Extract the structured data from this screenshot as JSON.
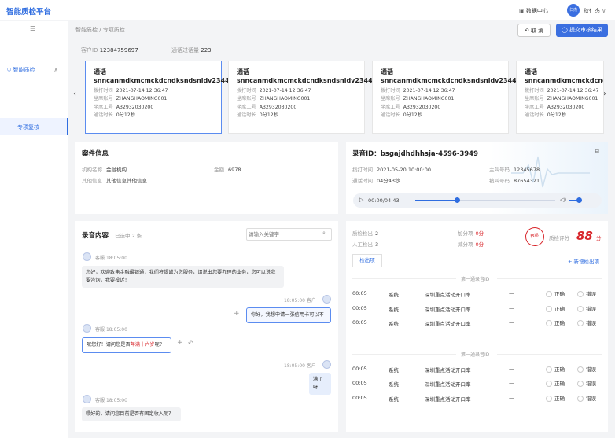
{
  "app": {
    "title": "智能质检平台",
    "data_center": "数据中心",
    "avatar_text": "仁杰",
    "user_name": "狄仁杰"
  },
  "sidebar": {
    "group": "智能质检",
    "active": "专项复核"
  },
  "breadcrumb": "智能质检 / 专项质检",
  "actions": {
    "cancel": "取 消",
    "submit": "提交审核结果"
  },
  "info": {
    "customer_id_label": "客户ID",
    "customer_id": "12384759697",
    "call_total_label": "通话过话量",
    "call_total": "223"
  },
  "cards": [
    {
      "title": "通话snncanmdkmcmckdcndksndsnidv2344455",
      "rows": [
        [
          "拨打时间",
          "2021-07-14  12:36:47"
        ],
        [
          "坐席账号",
          "ZHANGHAOMING001"
        ],
        [
          "坐席工号",
          "A32932030200"
        ],
        [
          "通话时长",
          "0分12秒"
        ]
      ]
    },
    {
      "title": "通话snncanmdkmcmckdcndksndsnidv2344455",
      "rows": [
        [
          "拨打时间",
          "2021-07-14  12:36:47"
        ],
        [
          "坐席账号",
          "ZHANGHAOMING001"
        ],
        [
          "坐席工号",
          "A32932030200"
        ],
        [
          "通话时长",
          "0分12秒"
        ]
      ]
    },
    {
      "title": "通话snncanmdkmcmckdcndksndsnidv2344455",
      "rows": [
        [
          "拨打时间",
          "2021-07-14  12:36:47"
        ],
        [
          "坐席账号",
          "ZHANGHAOMING001"
        ],
        [
          "坐席工号",
          "A32932030200"
        ],
        [
          "通话时长",
          "0分12秒"
        ]
      ]
    },
    {
      "title": "通话snncanmdkmcmckdcndksndsnidv2344455",
      "rows": [
        [
          "拨打时间",
          "2021-07-14  12:36:47"
        ],
        [
          "坐席账号",
          "ZHANGHAOMING001"
        ],
        [
          "坐席工号",
          "A32932030200"
        ],
        [
          "通话时长",
          "0分12秒"
        ]
      ]
    }
  ],
  "case": {
    "title": "案件信息",
    "org_label": "机构名称",
    "org": "金融机构",
    "amount_label": "金额",
    "amount": "6978",
    "other_label": "其他信息",
    "other": "其他信息其他信息"
  },
  "record": {
    "title": "录音ID：bsgajdhdhhsja-4596-3949",
    "call_time_label": "拨打时间",
    "call_time": "2021-05-20  10:00:00",
    "caller_label": "主叫号码",
    "caller": "12345678",
    "duration_label": "通话时间",
    "duration": "04分43秒",
    "callee_label": "被叫号码",
    "callee": "87654321",
    "player_time": "00:00/04:43",
    "progress": 0.3,
    "volume": 0.75
  },
  "content": {
    "title": "录音内容",
    "selected": "已选中 2 条",
    "search_placeholder": "请输入关键字",
    "messages": [
      {
        "role": "客服",
        "time": "18:05:00",
        "text": "您好，欢迎致电金融最银通，我们将竭诚为您服务，请说出您要办理的业务，您可以说我要咨询，我要投诉！"
      },
      {
        "role": "客户",
        "time": "18:05:00",
        "text": "你好，我想申请一张信用卡可以不"
      },
      {
        "role": "客服",
        "time": "18:05:00",
        "text_pre": "呢您好！请问您是否",
        "text_hl": "年满十六岁",
        "text_post": "呢？"
      },
      {
        "role": "客户",
        "time": "18:05:00",
        "text": "满了呀"
      },
      {
        "role": "客服",
        "time": "18:05:00",
        "text": "喂好的，请问您目前是否有固定收入呢？"
      }
    ]
  },
  "qc": {
    "detect_label": "质检检出",
    "detect": "2",
    "manual_label": "人工检出",
    "manual": "3",
    "add_label": "加分项",
    "add": "0分",
    "minus_label": "减分项",
    "minus": "0分",
    "stamp": "数据",
    "score_label": "质检评分",
    "score": "88",
    "score_unit": "分",
    "tab": "检出项",
    "add_btn": "+ 新增检出项",
    "sections": [
      {
        "label": "第一通录音ID",
        "rows": [
          [
            "00:05",
            "系统",
            "深圳重点活动开口率",
            "—"
          ],
          [
            "00:05",
            "系统",
            "深圳重点活动开口率",
            "—"
          ],
          [
            "00:05",
            "系统",
            "深圳重点活动开口率",
            "—"
          ]
        ]
      },
      {
        "label": "第一通录音ID",
        "rows": [
          [
            "00:05",
            "系统",
            "深圳重点活动开口率",
            "—"
          ],
          [
            "00:05",
            "系统",
            "深圳重点活动开口率",
            "—"
          ],
          [
            "00:05",
            "系统",
            "深圳重点活动开口率",
            "—"
          ]
        ]
      }
    ],
    "correct": "正确",
    "wrong": "错误"
  },
  "colors": {
    "brand": "#2f6de0",
    "score": "#d8262b",
    "highlight": "#d8262b"
  }
}
